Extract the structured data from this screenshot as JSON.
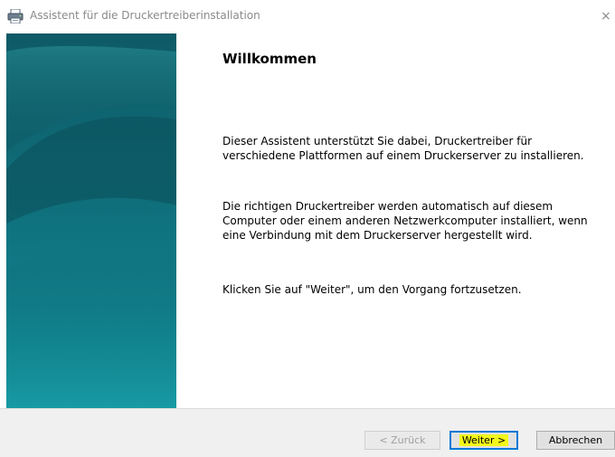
{
  "window": {
    "title": "Assistent für die Druckertreiberinstallation",
    "close_glyph": "×"
  },
  "page": {
    "heading": "Willkommen",
    "paragraphs": [
      "Dieser Assistent unterstützt Sie dabei, Druckertreiber für verschiedene Plattformen auf einem Druckerserver zu installieren.",
      "Die richtigen Druckertreiber werden automatisch auf diesem Computer oder einem anderen Netzwerkcomputer installiert, wenn eine Verbindung mit dem Druckerserver hergestellt wird.",
      "Klicken Sie auf \"Weiter\", um den Vorgang fortzusetzen."
    ]
  },
  "buttons": {
    "back": "< Zurück",
    "next": "Weiter >",
    "cancel": "Abbrechen"
  },
  "colors": {
    "banner_top": "#0e5a66",
    "banner_bottom": "#14949f",
    "focus_border": "#0078d7",
    "highlight": "#f3f71a"
  },
  "icons": {
    "title_icon": "printer-icon",
    "close": "close-icon"
  }
}
